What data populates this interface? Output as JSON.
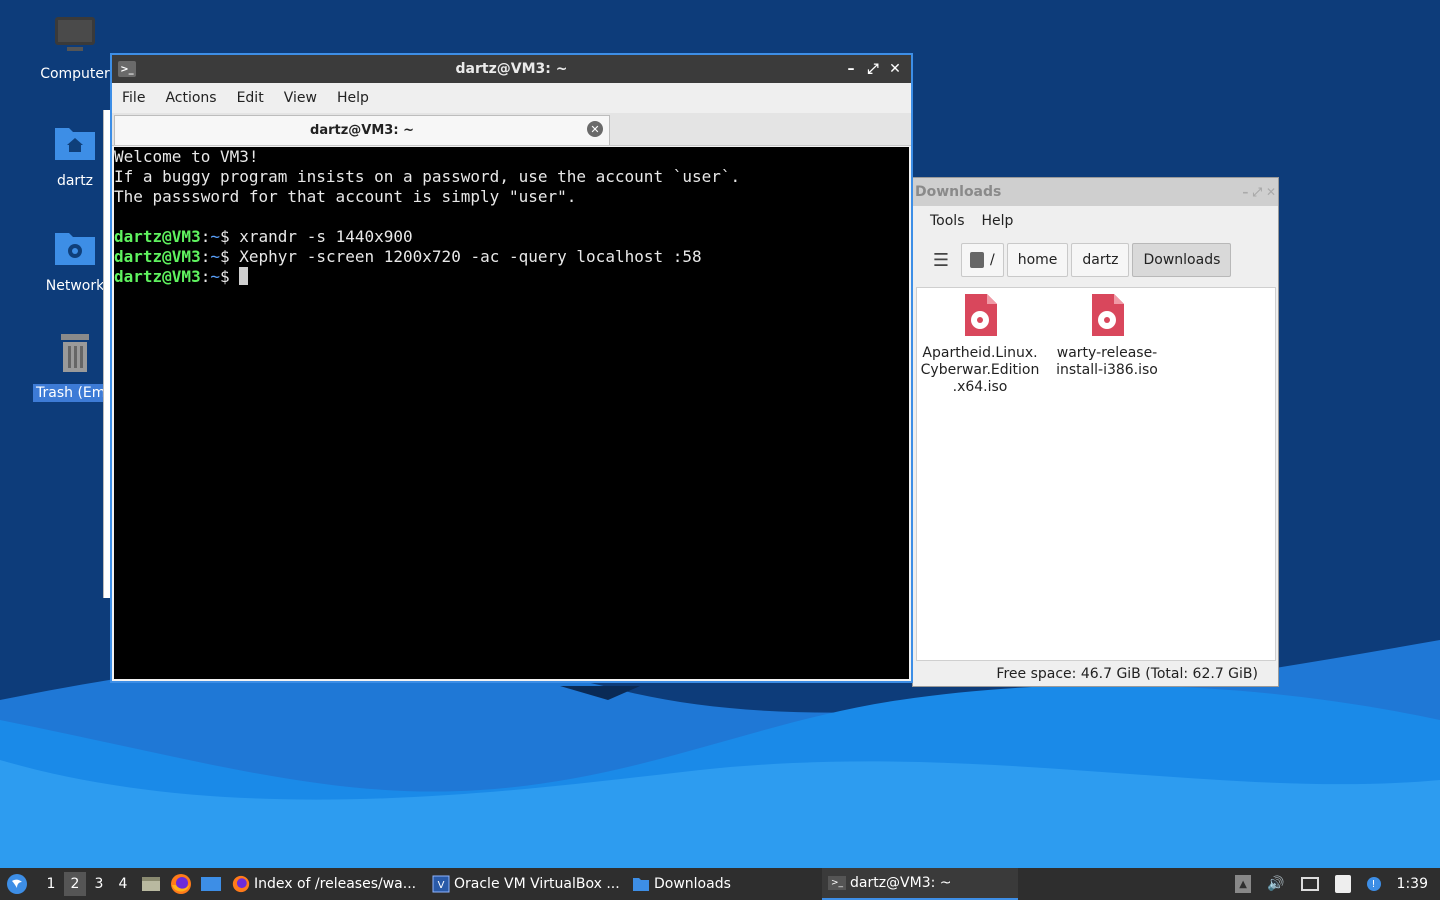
{
  "desktop": {
    "icons": [
      {
        "label": "Computer"
      },
      {
        "label": "dartz"
      },
      {
        "label": "Network"
      },
      {
        "label": "Trash (Empty)"
      }
    ]
  },
  "terminal": {
    "title": "dartz@VM3: ~",
    "menu": [
      "File",
      "Actions",
      "Edit",
      "View",
      "Help"
    ],
    "tab_label": "dartz@VM3: ~",
    "lines": [
      "Welcome to VM3!",
      "If a buggy program insists on a password, use the account `user`.",
      "The passsword for that account is simply \"user\"."
    ],
    "prompt_user": "dartz@VM3",
    "prompt_path": "~",
    "prompt_symbol": "$",
    "commands": [
      "xrandr -s 1440x900",
      "Xephyr -screen 1200x720 -ac -query localhost :58"
    ]
  },
  "filemanager": {
    "title": "Downloads",
    "menu": [
      "Tools",
      "Help"
    ],
    "path_root": "/",
    "path": [
      "home",
      "dartz",
      "Downloads"
    ],
    "files": [
      {
        "name": "Apartheid.Linux.Cyberwar.Edition.x64.iso",
        "lines": [
          "Apartheid.Linux.",
          "Cyberwar.Edition",
          ".x64.iso"
        ],
        "icon": "disc-image-icon"
      },
      {
        "name": "warty-release-install-i386.iso",
        "lines": [
          "warty-release-",
          "install-i386.iso"
        ],
        "icon": "disc-image-icon"
      }
    ],
    "status": "Free space: 46.7 GiB (Total: 62.7 GiB)"
  },
  "taskbar": {
    "workspaces": [
      "1",
      "2",
      "3",
      "4"
    ],
    "current_workspace": "2",
    "tasks": [
      {
        "label": "Index of /releases/wa...",
        "icon": "firefox-icon"
      },
      {
        "label": "Oracle VM VirtualBox ...",
        "icon": "virtualbox-icon"
      },
      {
        "label": "Downloads",
        "icon": "folder-icon"
      },
      {
        "label": "dartz@VM3: ~",
        "icon": "terminal-icon"
      }
    ],
    "clock": "1:39"
  },
  "colors": {
    "accent": "#3d8ee6",
    "terminal_bg": "#000000",
    "prompt_user": "#5ff25f",
    "prompt_path": "#5aa2ff",
    "iso_icon": "#d9475c"
  }
}
